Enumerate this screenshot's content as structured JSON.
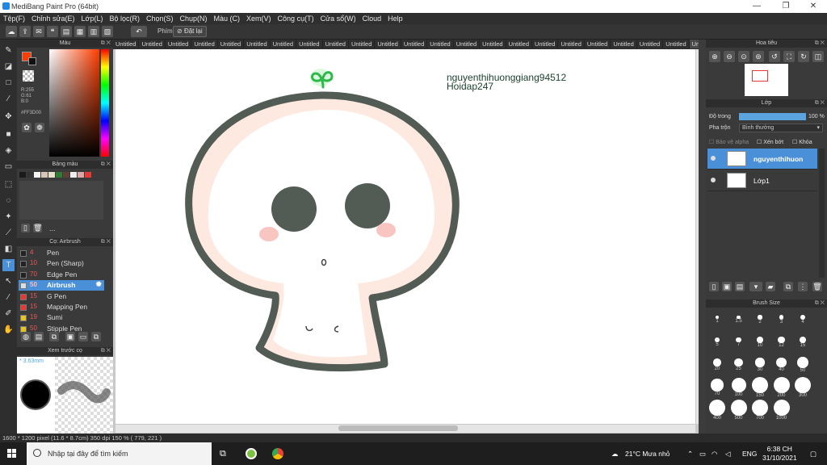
{
  "window": {
    "title": "MediBang Paint Pro (64bit)"
  },
  "menu": [
    "Tệp(F)",
    "Chỉnh sửa(E)",
    "Lớp(L)",
    "Bộ lọc(R)",
    "Chọn(S)",
    "Chụp(N)",
    "Màu (C)",
    "Xem(V)",
    "Công cụ(T)",
    "Cửa sổ(W)",
    "Cloud",
    "Help"
  ],
  "toolbar": {
    "key_label": "Phím",
    "reset_label": "Đặt lại"
  },
  "color_panel": {
    "title": "Màu",
    "fg_color": "#FF3D00",
    "r": "R:255",
    "g": "G:61",
    "b": "B:0",
    "hex": "#FF3D00"
  },
  "palette_panel": {
    "title": "Bảng màu",
    "swatches": [
      "#1a1a1a",
      "#333333",
      "#f5f5f5",
      "#d7c6b5",
      "#e8e0c8",
      "#2e7d32",
      "#5d4037",
      "#eeeeee",
      "#d9a7a7",
      "#e53935"
    ],
    "more": "..."
  },
  "brush_panel": {
    "title": "Cọ: Airbrush",
    "items": [
      {
        "num": "4",
        "name": "Pen",
        "chip": "#222222"
      },
      {
        "num": "10",
        "name": "Pen (Sharp)",
        "chip": "#222222"
      },
      {
        "num": "70",
        "name": "Edge Pen",
        "chip": "#222222"
      },
      {
        "num": "50",
        "name": "Airbrush",
        "chip": "#dddddd"
      },
      {
        "num": "15",
        "name": "G Pen",
        "chip": "#e53935"
      },
      {
        "num": "15",
        "name": "Mapping Pen",
        "chip": "#e53935"
      },
      {
        "num": "19",
        "name": "Sumi",
        "chip": "#e6c229"
      },
      {
        "num": "50",
        "name": "Stipple Pen",
        "chip": "#e6c229"
      }
    ]
  },
  "preview_panel": {
    "title": "Xem trước cọ",
    "size": "3.63mm"
  },
  "doc_tabs": [
    "Untitled",
    "Untitled",
    "Untitled",
    "Untitled",
    "Untitled",
    "Untitled",
    "Untitled",
    "Untitled",
    "Untitled",
    "Untitled",
    "Untitled",
    "Untitled",
    "Untitled",
    "Untitled",
    "Untitled",
    "Untitled",
    "Untitled",
    "Untitled",
    "Untitled",
    "Untitled",
    "Untitled",
    "Untitled",
    "Untitled"
  ],
  "canvas": {
    "watermark_line1": "nguyenthihuonggiang94512",
    "watermark_line2": "Hoidap247"
  },
  "navigator": {
    "title": "Hoa tiêu"
  },
  "layer_panel": {
    "title": "Lớp",
    "opacity_label": "Độ trong",
    "opacity_value": "100 %",
    "opacity_fraction": 1.0,
    "blend_label": "Pha trộn",
    "blend_value": "Bình thường",
    "protect_alpha": "Bảo vệ alpha",
    "clip": "Xén bớt",
    "lock": "Khóa",
    "layers": [
      {
        "name": "nguyenthihuon"
      },
      {
        "name": "Lớp1"
      }
    ]
  },
  "brush_size_panel": {
    "title": "Brush Size",
    "sizes": [
      "1",
      "1.5",
      "2",
      "3",
      "4",
      "5",
      "7",
      "10",
      "12",
      "15",
      "20",
      "25",
      "30",
      "40",
      "50",
      "70",
      "100",
      "150",
      "200",
      "300",
      "400",
      "500",
      "700",
      "1000"
    ]
  },
  "statusbar": {
    "text": "1600 * 1200 pixel   (11.6 * 8.7cm)   350 dpi   150 %   ( 779, 221 )"
  },
  "taskbar": {
    "search_placeholder": "Nhập tại đây để tìm kiếm",
    "weather": "21°C  Mưa nhỏ",
    "lang": "ENG",
    "time": "6:38 CH",
    "date": "31/10/2021"
  }
}
